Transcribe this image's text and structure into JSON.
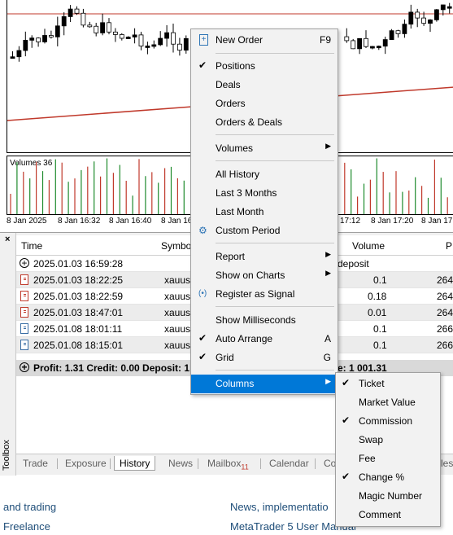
{
  "chart": {
    "volumes_label": "Volumes 36",
    "time_labels": [
      "8 Jan 2025",
      "8 Jan 16:32",
      "8 Jan 16:40",
      "8 Jan 16",
      "17:12",
      "8 Jan 17:20",
      "8 Jan 17:"
    ]
  },
  "grid": {
    "headers": [
      "Time",
      "Symbo",
      "Volume",
      "P"
    ],
    "group_row": {
      "time": "2025.01.03 16:59:28",
      "tail": "deposit"
    },
    "rows": [
      {
        "time": "2025.01.03 18:22:25",
        "symbol": "xauus",
        "volume": "0.1",
        "price": "264",
        "icon": "red"
      },
      {
        "time": "2025.01.03 18:22:59",
        "symbol": "xauus",
        "volume": "0.18",
        "price": "264",
        "icon": "red"
      },
      {
        "time": "2025.01.03 18:47:01",
        "symbol": "xauus",
        "volume": "0.01",
        "price": "264",
        "icon": "red"
      },
      {
        "time": "2025.01.08 18:01:11",
        "symbol": "xauus",
        "volume": "0.1",
        "price": "266",
        "icon": "blue"
      },
      {
        "time": "2025.01.08 18:15:01",
        "symbol": "xauus",
        "volume": "0.1",
        "price": "266",
        "icon": "blue"
      }
    ],
    "summary": {
      "left": "Profit: 1.31  Credit: 0.00  Deposit: 1",
      "right": "e: 1 001.31"
    }
  },
  "toolbox_label": "Toolbox",
  "tabs": [
    {
      "label": "Trade",
      "active": false
    },
    {
      "label": "Exposure",
      "active": false
    },
    {
      "label": "History",
      "active": true
    },
    {
      "label": "News",
      "active": false
    },
    {
      "label": "Mailbox",
      "active": false,
      "badge": "11"
    },
    {
      "label": "Calendar",
      "active": false
    },
    {
      "label": "Co",
      "active": false
    },
    {
      "label": "cles",
      "active": false
    }
  ],
  "bottom_links": [
    "and trading",
    "Freelance",
    "News, implementatio",
    "MetaTrader 5 User Manual"
  ],
  "context_menu": {
    "items": [
      {
        "label": "New Order",
        "shortcut": "F9",
        "icon": "new-order-icon"
      },
      {
        "sep": true
      },
      {
        "label": "Positions",
        "checked": true
      },
      {
        "label": "Deals"
      },
      {
        "label": "Orders"
      },
      {
        "label": "Orders & Deals"
      },
      {
        "sep": true
      },
      {
        "label": "Volumes",
        "submenu": true
      },
      {
        "sep": true
      },
      {
        "label": "All History"
      },
      {
        "label": "Last 3 Months"
      },
      {
        "label": "Last Month"
      },
      {
        "label": "Custom Period",
        "icon": "gear-icon"
      },
      {
        "sep": true
      },
      {
        "label": "Report",
        "submenu": true
      },
      {
        "label": "Show on Charts",
        "submenu": true
      },
      {
        "label": "Register as Signal",
        "icon": "signal-icon"
      },
      {
        "sep": true
      },
      {
        "label": "Show Milliseconds"
      },
      {
        "label": "Auto Arrange",
        "checked": true,
        "shortcut": "A"
      },
      {
        "label": "Grid",
        "checked": true,
        "shortcut": "G"
      },
      {
        "sep": true
      },
      {
        "label": "Columns",
        "submenu": true,
        "highlighted": true
      }
    ]
  },
  "columns_submenu": {
    "items": [
      {
        "label": "Ticket",
        "checked": true
      },
      {
        "label": "Market Value",
        "checked": false
      },
      {
        "label": "Commission",
        "checked": true
      },
      {
        "label": "Swap",
        "checked": false
      },
      {
        "label": "Fee",
        "checked": false
      },
      {
        "label": "Change %",
        "checked": true
      },
      {
        "label": "Magic Number",
        "checked": false
      },
      {
        "label": "Comment",
        "checked": false
      }
    ]
  }
}
